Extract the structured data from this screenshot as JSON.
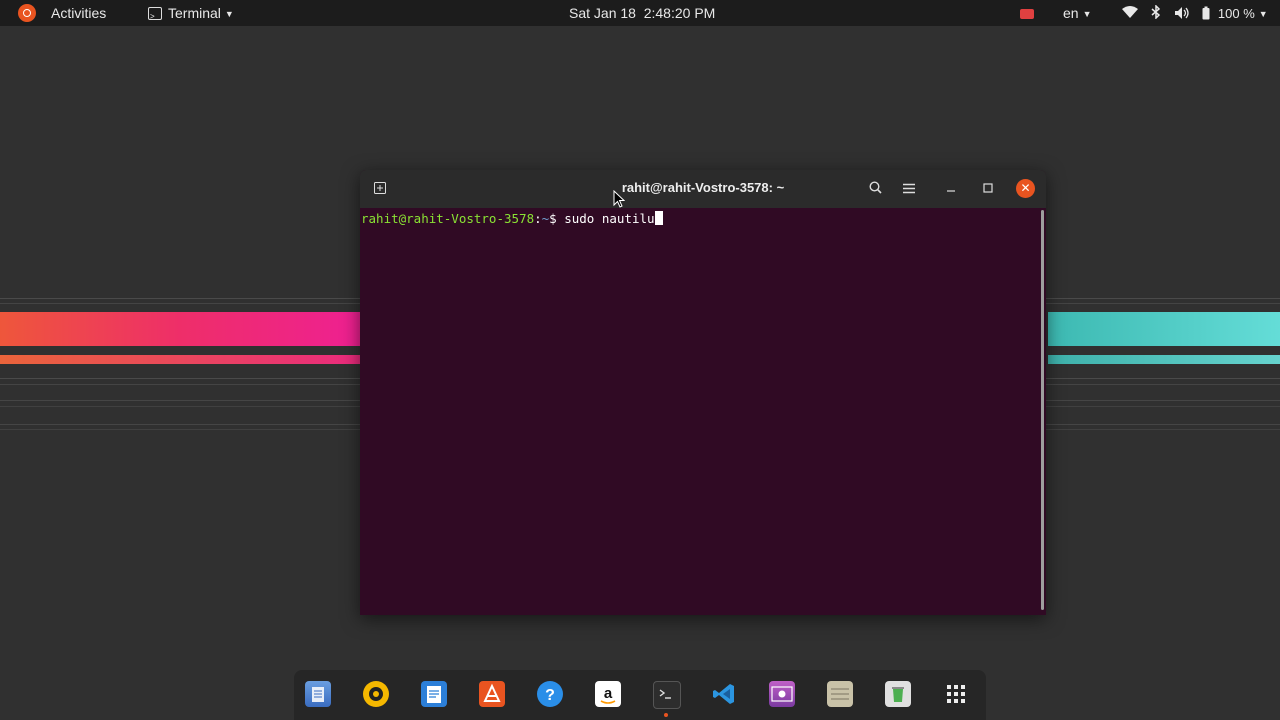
{
  "topbar": {
    "activities": "Activities",
    "app_menu": "Terminal",
    "clock": "Sat Jan 18  2:48:20 PM",
    "language": "en",
    "battery": "100 %"
  },
  "window": {
    "title": "rahit@rahit-Vostro-3578: ~",
    "prompt_user": "rahit@rahit-Vostro-3578",
    "prompt_path": "~",
    "command": "sudo nautilu"
  },
  "dock": {
    "items": [
      "files-icon",
      "rhythmbox-icon",
      "writer-icon",
      "software-icon",
      "help-icon",
      "amazon-icon",
      "terminal-icon",
      "vscode-icon",
      "screen-recorder-icon",
      "archive-icon",
      "trash-icon",
      "show-apps-icon"
    ]
  },
  "colors": {
    "accent": "#e95420",
    "terminal_bg": "#300a24",
    "prompt_user": "#8ae234",
    "prompt_path": "#729fcf"
  }
}
